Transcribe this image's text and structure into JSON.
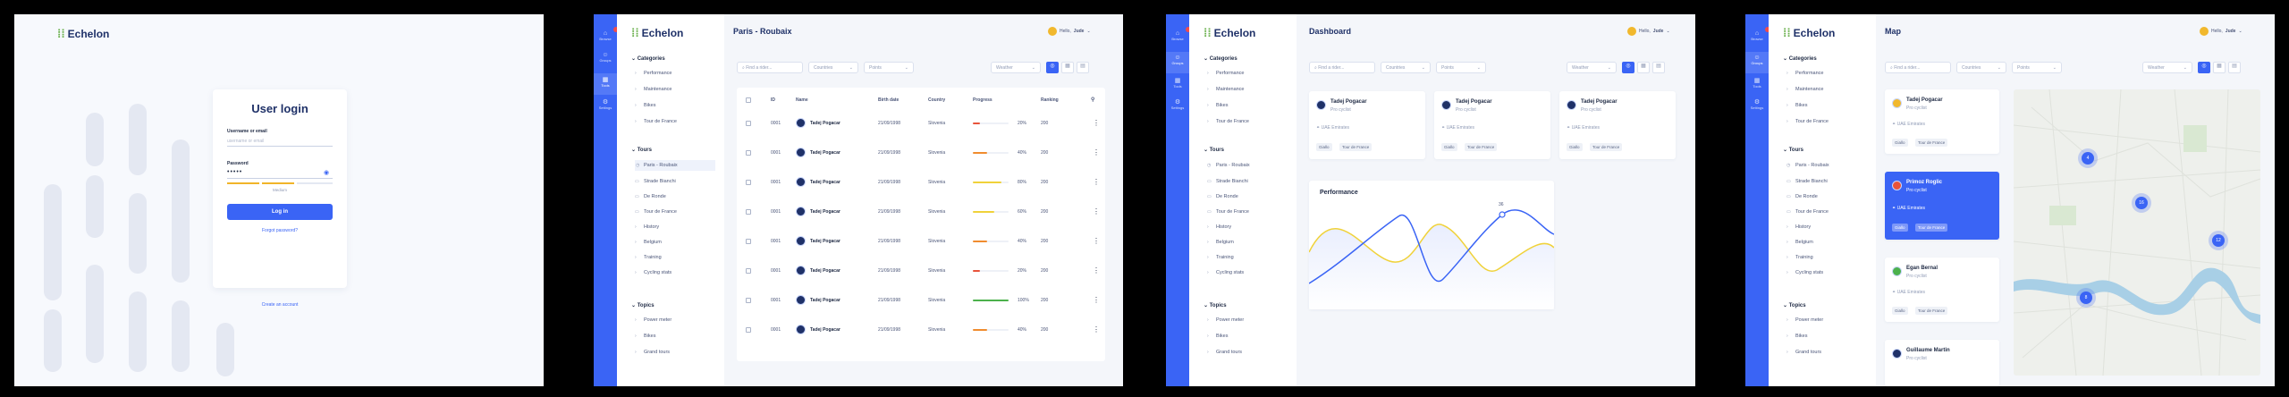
{
  "brand": {
    "name": "Echelon",
    "mark": "⁞⁞"
  },
  "login": {
    "title": "User login",
    "username_label": "Username or email",
    "username_placeholder": "username or email",
    "password_label": "Password",
    "password_value": "•••••",
    "strength": "Medium",
    "login_button": "Log in",
    "forgot": "Forgot password?",
    "create": "Create an account"
  },
  "rail": [
    "Browse",
    "Groups",
    "Tools",
    "Settings"
  ],
  "sidebar": {
    "categories_title": "Categories",
    "categories": [
      "Performance",
      "Maintenance",
      "Bikes",
      "Tour de France"
    ],
    "tours_title": "Tours",
    "tours": [
      "Paris - Roubaix",
      "Strade Bianchi",
      "De Ronde",
      "Tour de France",
      "History",
      "Belgium",
      "Training",
      "Cycling stats"
    ],
    "topics_title": "Topics",
    "topics": [
      "Power meter",
      "Bikes",
      "Grand tours"
    ]
  },
  "user": {
    "greeting": "Hello,",
    "name": "Jude"
  },
  "filters": {
    "search": "Find a rider...",
    "countries": "Countries",
    "points": "Points",
    "weather": "Weather"
  },
  "table": {
    "title": "Paris - Roubaix",
    "headers": [
      "ID",
      "Name",
      "Birth date",
      "Country",
      "Progress",
      "Ranking"
    ],
    "rows": [
      {
        "id": "0001",
        "name": "Tadej Pogacar",
        "birth": "21/09/1998",
        "country": "Slovenia",
        "progress": 20,
        "ranking": "200",
        "color": "#e8533a"
      },
      {
        "id": "0001",
        "name": "Tadej Pogacar",
        "birth": "21/09/1998",
        "country": "Slovenia",
        "progress": 40,
        "ranking": "200",
        "color": "#f08c2e"
      },
      {
        "id": "0001",
        "name": "Tadej Pogacar",
        "birth": "21/09/1998",
        "country": "Slovenia",
        "progress": 80,
        "ranking": "200",
        "color": "#f0d23a"
      },
      {
        "id": "0001",
        "name": "Tadej Pogacar",
        "birth": "21/09/1998",
        "country": "Slovenia",
        "progress": 60,
        "ranking": "200",
        "color": "#f0d23a"
      },
      {
        "id": "0001",
        "name": "Tadej Pogacar",
        "birth": "21/09/1998",
        "country": "Slovenia",
        "progress": 40,
        "ranking": "200",
        "color": "#f08c2e"
      },
      {
        "id": "0001",
        "name": "Tadej Pogacar",
        "birth": "21/09/1998",
        "country": "Slovenia",
        "progress": 20,
        "ranking": "200",
        "color": "#e8533a"
      },
      {
        "id": "0001",
        "name": "Tadej Pogacar",
        "birth": "21/09/1998",
        "country": "Slovenia",
        "progress": 100,
        "ranking": "200",
        "color": "#4cb14c"
      },
      {
        "id": "0001",
        "name": "Tadej Pogacar",
        "birth": "21/09/1998",
        "country": "Slovenia",
        "progress": 40,
        "ranking": "200",
        "color": "#f08c2e"
      }
    ]
  },
  "dashboard": {
    "title": "Dashboard",
    "cards": [
      {
        "name": "Tadej Pogacar",
        "role": "Pro cyclist",
        "team": "UAE Emirates",
        "chips": [
          "Giallo",
          "Tour de France"
        ]
      },
      {
        "name": "Tadej Pogacar",
        "role": "Pro cyclist",
        "team": "UAE Emirates",
        "chips": [
          "Giallo",
          "Tour de France"
        ]
      },
      {
        "name": "Tadej Pogacar",
        "role": "Pro cyclist",
        "team": "UAE Emirates",
        "chips": [
          "Giallo",
          "Tour de France"
        ]
      }
    ],
    "performance_title": "Performance",
    "peak_label": "36"
  },
  "map": {
    "title": "Map",
    "riders": [
      {
        "name": "Tadej Pogacar",
        "role": "Pro cyclist",
        "team": "UAE Emirates",
        "chips": [
          "Giallo",
          "Tour de France"
        ]
      },
      {
        "name": "Primoz Roglic",
        "role": "Pro cyclist",
        "team": "UAE Emirates",
        "chips": [
          "Giallo",
          "Tour de France"
        ]
      },
      {
        "name": "Egan Bernal",
        "role": "Pro cyclist",
        "team": "UAE Emirates",
        "chips": [
          "Giallo",
          "Tour de France"
        ]
      },
      {
        "name": "Guillaume Martin",
        "role": "Pro cyclist"
      }
    ],
    "clusters": [
      "4",
      "16",
      "12",
      "8"
    ]
  },
  "colors": {
    "accent": "#3a64f5",
    "navy": "#1f3168",
    "green": "#6ab04c"
  }
}
